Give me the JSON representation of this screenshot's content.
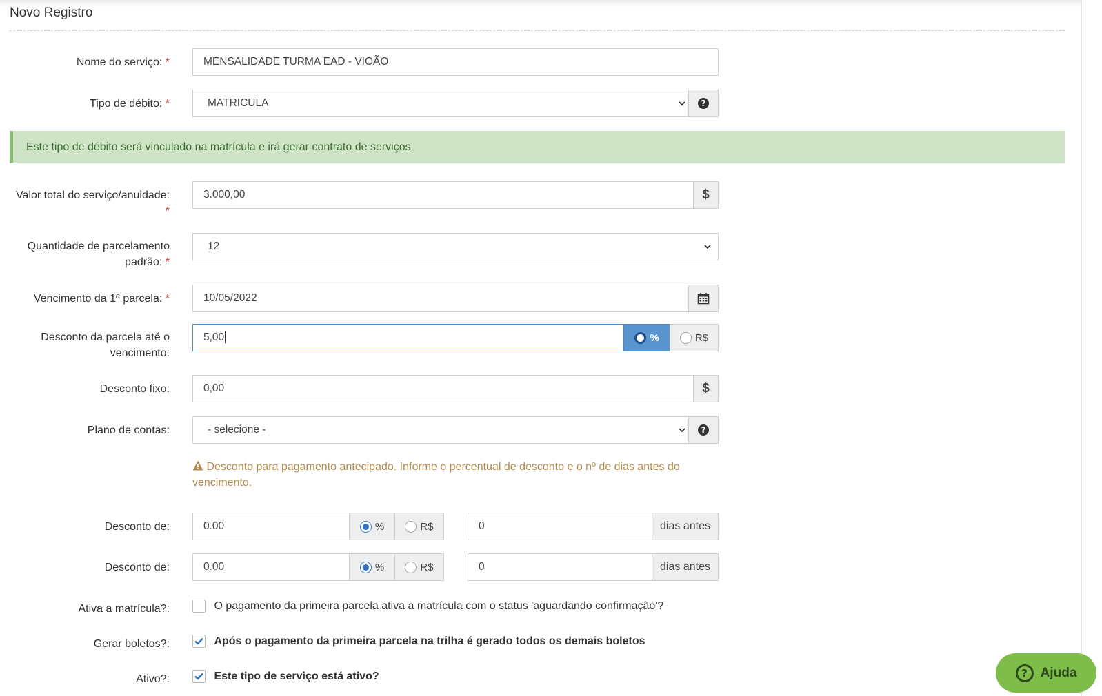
{
  "page": {
    "title": "Novo Registro"
  },
  "colors": {
    "accent": "#2f72c9",
    "alert_bg": "#cfe3c6",
    "warning": "#b38b4d",
    "help_bg": "#7fbd4a"
  },
  "form": {
    "service_name": {
      "label": "Nome do serviço:",
      "required": "*",
      "value": "MENSALIDADE TURMA EAD - VIOÃO"
    },
    "debit_type": {
      "label": "Tipo de débito:",
      "required": "*",
      "value": "MATRICULA",
      "help_icon": "question-circle-icon"
    },
    "debit_alert": "Este tipo de débito será vinculado na matrícula e irá gerar contrato de serviços",
    "total_value": {
      "label": "Valor total do serviço/anuidade:",
      "required": "*",
      "value": "3.000,00",
      "addon": "$"
    },
    "installments": {
      "label_line1": "Quantidade de parcelamento",
      "label_line2": "padrão:",
      "required": "*",
      "value": "12"
    },
    "first_due": {
      "label": "Vencimento da 1ª parcela:",
      "required": "*",
      "value": "10/05/2022",
      "icon": "calendar-icon"
    },
    "installment_discount": {
      "label_line1": "Desconto da parcela até o",
      "label_line2": "vencimento:",
      "value": "5,00",
      "opt_percent": "%",
      "opt_currency": "R$",
      "selected": "%"
    },
    "fixed_discount": {
      "label": "Desconto fixo:",
      "value": "0,00",
      "addon": "$"
    },
    "chart_of_accounts": {
      "label": "Plano de contas:",
      "value": "- selecione -",
      "help_icon": "question-circle-icon"
    },
    "early_warning": "Desconto para pagamento antecipado. Informe o percentual de desconto e o nº de dias antes do vencimento.",
    "early_discounts": [
      {
        "label": "Desconto de:",
        "value": "0.00",
        "opt_percent": "%",
        "opt_currency": "R$",
        "days": "0",
        "days_addon": "dias antes"
      },
      {
        "label": "Desconto de:",
        "value": "0.00",
        "opt_percent": "%",
        "opt_currency": "R$",
        "days": "0",
        "days_addon": "dias antes"
      }
    ],
    "activate_enrollment": {
      "label": "Ativa a matrícula?:",
      "text": "O pagamento da primeira parcela ativa a matrícula com o status 'aguardando confirmação'?",
      "checked": false
    },
    "generate_slips": {
      "label": "Gerar boletos?:",
      "text": "Após o pagamento da primeira parcela na trilha é gerado todos os demais boletos",
      "checked": true
    },
    "active": {
      "label": "Ativo?:",
      "text": "Este tipo de serviço está ativo?",
      "checked": true
    }
  },
  "help_button": {
    "label": "Ajuda"
  }
}
